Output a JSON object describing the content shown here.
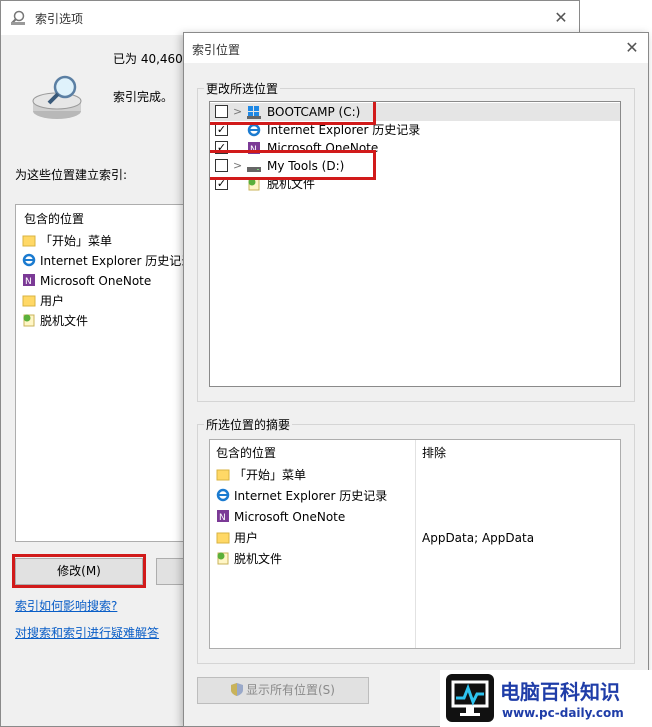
{
  "options_window": {
    "title": "索引选项",
    "count_text": "已为 40,460",
    "status_text": "索引完成。",
    "list_label": "为这些位置建立索引:",
    "list_header": "包含的位置",
    "items": [
      {
        "label": "「开始」菜单",
        "icon": "folder-icon"
      },
      {
        "label": "Internet Explorer 历史记录",
        "icon": "ie-icon"
      },
      {
        "label": "Microsoft OneNote",
        "icon": "onenote-icon"
      },
      {
        "label": "用户",
        "icon": "folder-icon"
      },
      {
        "label": "脱机文件",
        "icon": "offline-files-icon"
      }
    ],
    "modify_button": "修改(M)",
    "link_how": "索引如何影响搜索?",
    "link_troubleshoot": "对搜索和索引进行疑难解答"
  },
  "locations_window": {
    "title": "索引位置",
    "change_label": "更改所选位置",
    "tree": [
      {
        "label": "BOOTCAMP (C:)",
        "checked": false,
        "expandable": true,
        "icon": "windows-drive-icon"
      },
      {
        "label": "Internet Explorer 历史记录",
        "checked": true,
        "expandable": false,
        "icon": "ie-icon"
      },
      {
        "label": "Microsoft OneNote",
        "checked": true,
        "expandable": false,
        "icon": "onenote-icon"
      },
      {
        "label": "My Tools (D:)",
        "checked": false,
        "expandable": true,
        "icon": "drive-icon"
      },
      {
        "label": "脱机文件",
        "checked": true,
        "expandable": false,
        "icon": "offline-files-icon"
      }
    ],
    "summary_label": "所选位置的摘要",
    "summary_col_included": "包含的位置",
    "summary_col_excluded": "排除",
    "summary_rows": [
      {
        "label": "「开始」菜单",
        "icon": "folder-icon",
        "excluded": ""
      },
      {
        "label": "Internet Explorer 历史记录",
        "icon": "ie-icon",
        "excluded": ""
      },
      {
        "label": "Microsoft OneNote",
        "icon": "onenote-icon",
        "excluded": ""
      },
      {
        "label": "用户",
        "icon": "folder-icon",
        "excluded": "AppData; AppData"
      },
      {
        "label": "脱机文件",
        "icon": "offline-files-icon",
        "excluded": ""
      }
    ],
    "show_all_button": "显示所有位置(S)"
  },
  "watermark": {
    "title": "电脑百科知识",
    "url": "www.pc-daily.com"
  },
  "colors": {
    "highlight_red": "#d11a1a",
    "link_blue": "#0a5ec7",
    "watermark_blue": "#1f3da8"
  }
}
